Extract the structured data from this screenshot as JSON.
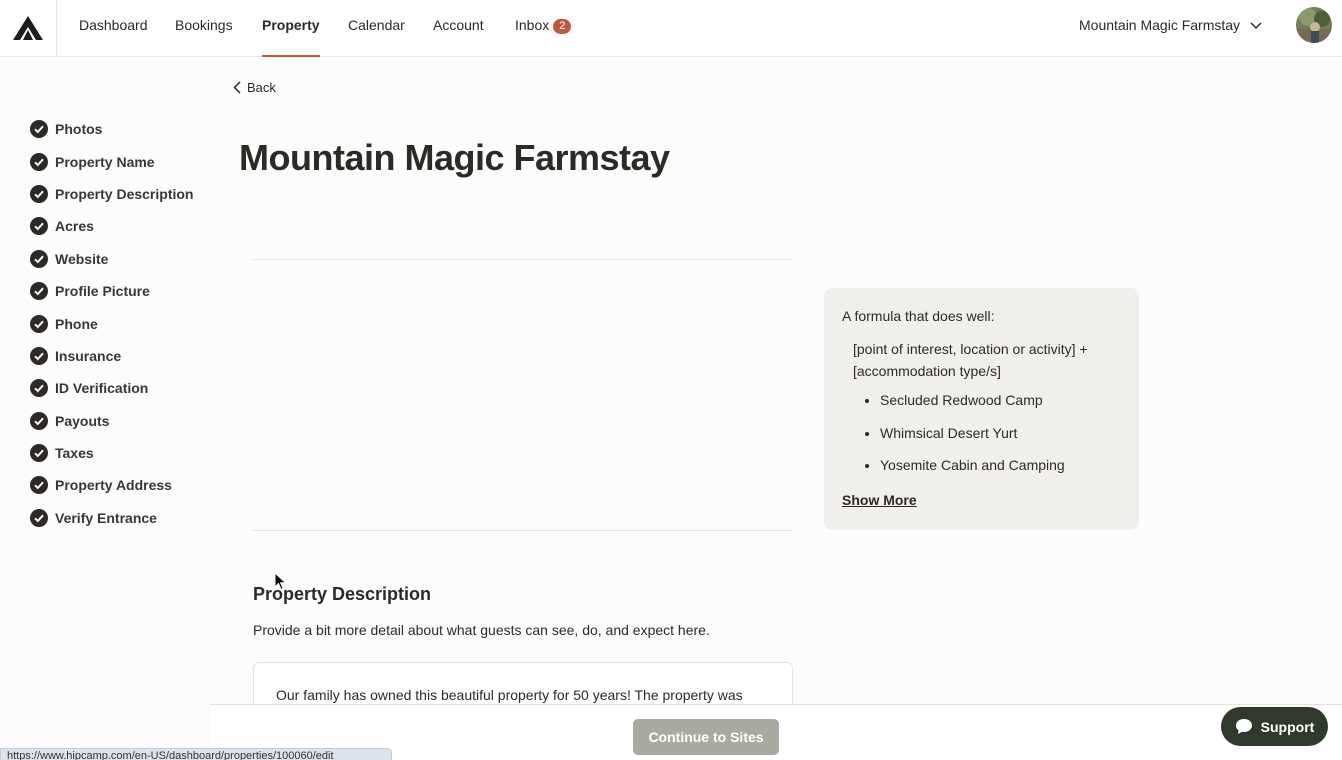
{
  "nav": {
    "links": [
      "Dashboard",
      "Bookings",
      "Property",
      "Calendar",
      "Account",
      "Inbox"
    ],
    "active": "Property",
    "inbox_count": "2",
    "property_switcher": "Mountain Magic Farmstay"
  },
  "sidebar": {
    "items": [
      {
        "label": "Photos"
      },
      {
        "label": "Property Name"
      },
      {
        "label": "Property Description"
      },
      {
        "label": "Acres"
      },
      {
        "label": "Website"
      },
      {
        "label": "Profile Picture"
      },
      {
        "label": "Phone"
      },
      {
        "label": "Insurance"
      },
      {
        "label": "ID Verification"
      },
      {
        "label": "Payouts"
      },
      {
        "label": "Taxes"
      },
      {
        "label": "Property Address"
      },
      {
        "label": "Verify Entrance"
      }
    ]
  },
  "main": {
    "back_label": "Back",
    "title": "Mountain Magic Farmstay",
    "tip": {
      "intro": "A formula that does well:",
      "formula": "[point of interest, location or activity] + [accommodation type/s]",
      "examples": [
        "Secluded Redwood Camp",
        "Whimsical Desert Yurt",
        "Yosemite Cabin and Camping"
      ],
      "show_more": "Show More"
    },
    "description_section": {
      "title": "Property Description",
      "help": "Provide a bit more detail about what guests can see, do, and expect here.",
      "value": "Our family has owned this beautiful property for 50 years! The property was"
    }
  },
  "footer": {
    "continue_label": "Continue to Sites",
    "support_label": "Support",
    "status_url": "https://www.hipcamp.com/en-US/dashboard/properties/100060/edit"
  },
  "colors": {
    "accent": "#c2583a",
    "primary_dark": "#2f3a2c",
    "check": "#2d2a26",
    "disabled_button": "#a9aba0"
  }
}
